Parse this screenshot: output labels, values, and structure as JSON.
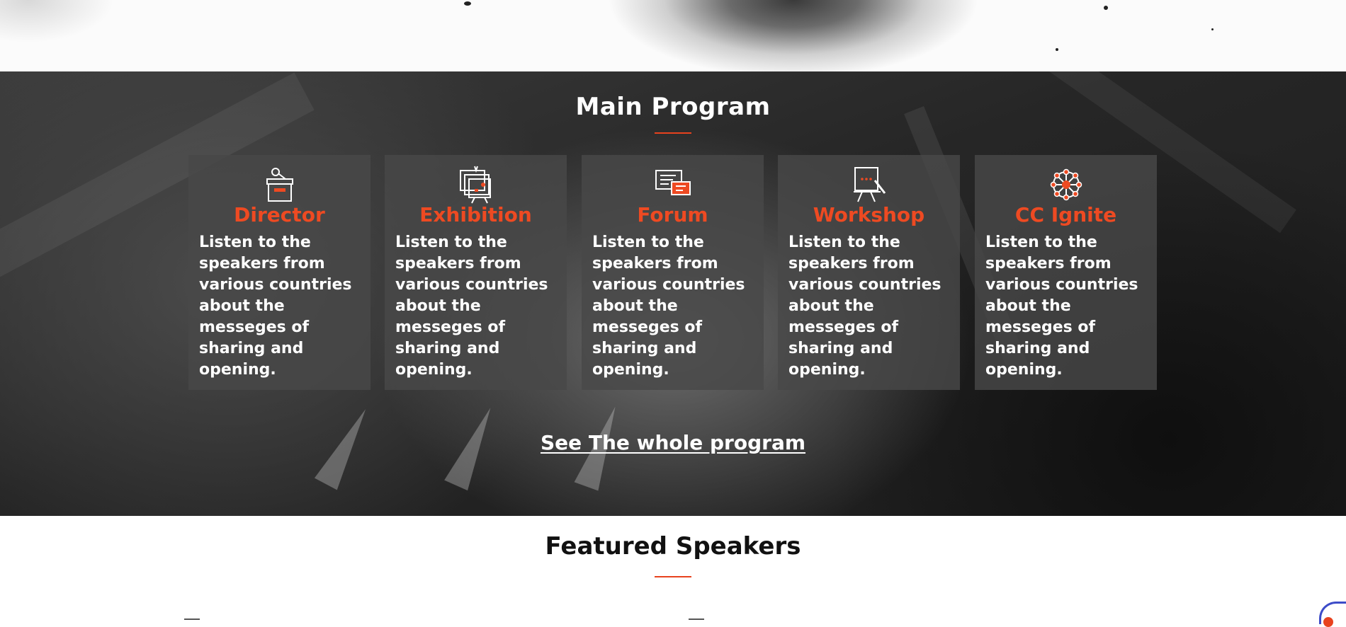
{
  "program": {
    "title": "Main Program",
    "cards": [
      {
        "title": "Director",
        "icon": "podium-icon",
        "text": "Listen to the speakers from various countries about the messeges of sharing and opening."
      },
      {
        "title": "Exhibition",
        "icon": "gallery-frames-icon",
        "text": "Listen to the speakers from various countries about the messeges of sharing and opening."
      },
      {
        "title": "Forum",
        "icon": "chat-bubbles-icon",
        "text": "Listen to the speakers from various countries about the messeges of sharing and opening."
      },
      {
        "title": "Workshop",
        "icon": "easel-icon",
        "text": "Listen to the speakers from various countries about the messeges of sharing and opening."
      },
      {
        "title": "CC Ignite",
        "icon": "network-icon",
        "text": "Listen to the speakers from various countries about the messeges of sharing and opening."
      }
    ],
    "link_label": "See The whole program"
  },
  "speakers": {
    "title": "Featured Speakers"
  },
  "colors": {
    "accent": "#ee4a22",
    "dark_bg": "#262626",
    "card_bg": "#484848",
    "chat_widget": "#3d4cc8"
  }
}
